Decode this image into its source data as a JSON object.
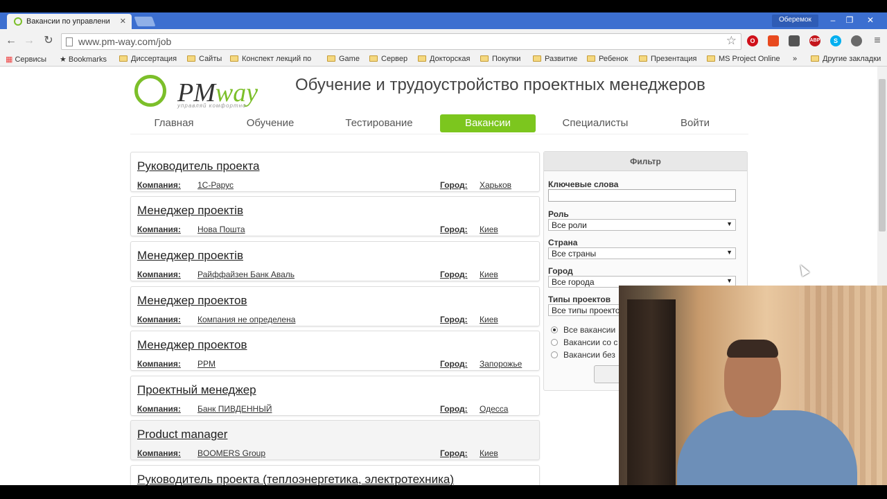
{
  "browser": {
    "tab_title": "Вакансии по управлени",
    "profile": "Оберемок",
    "url": "www.pm-way.com/job",
    "bookmarks": [
      "Сервисы",
      "Bookmarks",
      "Диссертация",
      "Сайты",
      "Конспект лекций по",
      "Game",
      "Сервер",
      "Докторская",
      "Покупки",
      "Развитие",
      "Ребенок",
      "Презентация",
      "MS Project Online",
      "»",
      "Другие закладки"
    ]
  },
  "site": {
    "logo_pm": "PM",
    "logo_way": "way",
    "logo_tagline": "управляй комфортно",
    "title": "Обучение и трудоустройство проектных менеджеров",
    "menu": [
      "Главная",
      "Обучение",
      "Тестирование",
      "Вакансии",
      "Специалисты",
      "Войти"
    ],
    "active_menu": "Вакансии",
    "accent_color": "#7cc61e"
  },
  "jobs": {
    "company_label": "Компания:",
    "city_label": "Город:",
    "items": [
      {
        "title": "Руководитель проекта",
        "company": "1С-Рарус",
        "city": "Харьков"
      },
      {
        "title": "Менеджер проектів",
        "company": "Нова Пошта",
        "city": "Киев"
      },
      {
        "title": "Менеджер проектів",
        "company": "Райффайзен Банк Аваль",
        "city": "Киев"
      },
      {
        "title": "Менеджер проектов",
        "company": "Компания не определена",
        "city": "Киев"
      },
      {
        "title": "Менеджер проектов",
        "company": "PPM",
        "city": "Запорожье"
      },
      {
        "title": "Проектный менеджер",
        "company": "Банк ПИВДЕННЫЙ",
        "city": "Одесса"
      },
      {
        "title": "Product manager",
        "company": "BOOMERS Group",
        "city": "Киев"
      },
      {
        "title": "Руководитель проекта (теплоэнергетика, электротехника)",
        "company": "",
        "city": ""
      }
    ]
  },
  "filter": {
    "heading": "Фильтр",
    "keywords_label": "Ключевые слова",
    "keywords_value": "",
    "role_label": "Роль",
    "role_value": "Все роли",
    "country_label": "Страна",
    "country_value": "Все страны",
    "city_label": "Город",
    "city_value": "Все города",
    "project_types_label": "Типы проектов",
    "project_types_value": "Все типы проекто",
    "radios": [
      "Все вакансии",
      "Вакансии со с",
      "Вакансии без"
    ]
  }
}
